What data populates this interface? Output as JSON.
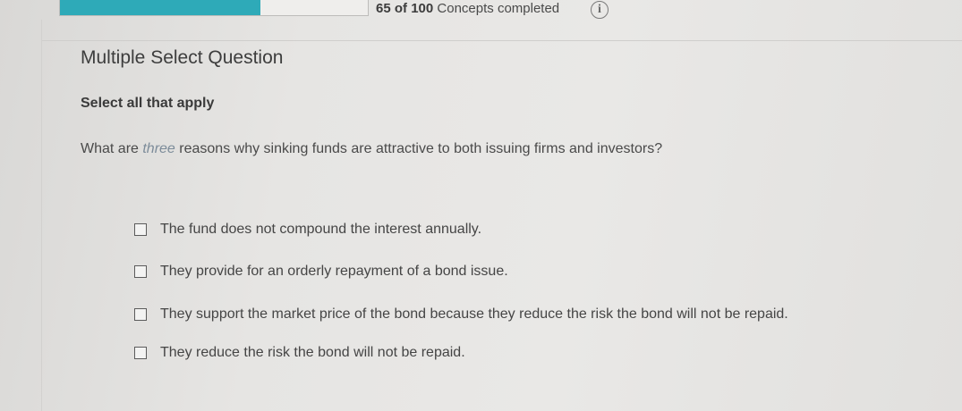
{
  "progress": {
    "completed": "65",
    "of_label": "of",
    "total": "100",
    "suffix": "Concepts completed",
    "fraction": 0.65,
    "fill_color": "#2eaab8",
    "info_glyph": "i"
  },
  "question": {
    "type": "Multiple Select Question",
    "instructions": "Select all that apply",
    "text_before": "What are ",
    "text_emphasis": "three",
    "text_after": " reasons why sinking funds are attractive to both issuing firms and investors?"
  },
  "options": [
    {
      "label": "The fund does not compound the interest annually.",
      "checked": false
    },
    {
      "label": "They provide for an orderly repayment of a bond issue.",
      "checked": false
    },
    {
      "label": "They support the market price of the bond because they reduce the risk the bond will not be repaid.",
      "checked": false
    },
    {
      "label": "They reduce the risk the bond will not be repaid.",
      "checked": false
    }
  ]
}
